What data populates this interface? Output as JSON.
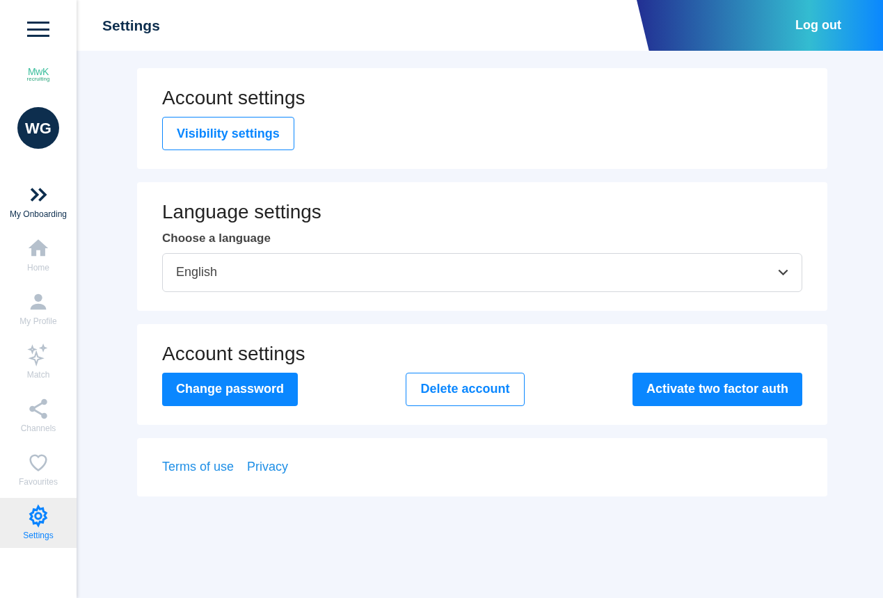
{
  "header": {
    "title": "Settings",
    "logout": "Log out"
  },
  "sidebar": {
    "logo": {
      "main": "MwK",
      "sub": "recruiting"
    },
    "avatar": "WG",
    "items": [
      {
        "kind": "onboarding",
        "label": "My Onboarding",
        "selected": false,
        "disabled": false
      },
      {
        "kind": "home",
        "label": "Home",
        "selected": false,
        "disabled": true
      },
      {
        "kind": "profile",
        "label": "My Profile",
        "selected": false,
        "disabled": true
      },
      {
        "kind": "match",
        "label": "Match",
        "selected": false,
        "disabled": true
      },
      {
        "kind": "channels",
        "label": "Channels",
        "selected": false,
        "disabled": true
      },
      {
        "kind": "favourites",
        "label": "Favourites",
        "selected": false,
        "disabled": true
      },
      {
        "kind": "settings",
        "label": "Settings",
        "selected": true,
        "disabled": false
      }
    ]
  },
  "cards": [
    {
      "kind": "buttons",
      "title": "Account settings",
      "buttons": [
        {
          "label": "Visibility settings",
          "kind": "outline"
        }
      ]
    },
    {
      "kind": "select",
      "title": "Language settings",
      "label": "Choose a language",
      "value": "English"
    },
    {
      "kind": "button-row",
      "title": "Account settings",
      "buttons": [
        {
          "label": "Change password",
          "kind": "filled"
        },
        {
          "label": "Delete account",
          "kind": "outline"
        },
        {
          "label": "Activate two factor auth",
          "kind": "filled"
        }
      ]
    },
    {
      "kind": "links",
      "links": [
        "Terms of use",
        "Privacy"
      ]
    }
  ]
}
